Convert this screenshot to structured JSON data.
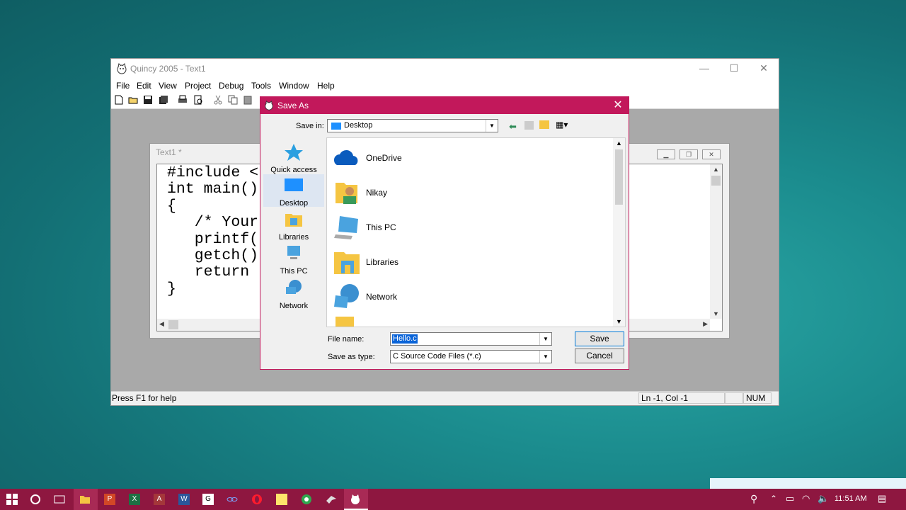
{
  "app": {
    "title": "Quincy 2005 - Text1",
    "menu": [
      "File",
      "Edit",
      "View",
      "Project",
      "Debug",
      "Tools",
      "Window",
      "Help"
    ],
    "status": {
      "help": "Press F1 for help",
      "position": "Ln -1, Col -1",
      "num": "NUM"
    }
  },
  "editor": {
    "window_title": "Text1 *",
    "code_lines": [
      "#include <",
      "int main()",
      "{",
      "   /* Your",
      "   printf(",
      "   getch()",
      "   return",
      "}"
    ]
  },
  "dialog": {
    "title": "Save As",
    "save_in_label": "Save in:",
    "save_in_value": "Desktop",
    "places": [
      "Quick access",
      "Desktop",
      "Libraries",
      "This PC",
      "Network"
    ],
    "files": [
      "OneDrive",
      "Nikay",
      "This PC",
      "Libraries",
      "Network"
    ],
    "file_name_label": "File name:",
    "file_name_value": "Hello.c",
    "save_type_label": "Save as type:",
    "save_type_value": "C Source Code Files (*.c)",
    "save_button": "Save",
    "cancel_button": "Cancel",
    "close_glyph": "✕"
  },
  "taskbar": {
    "time": "11:51 AM",
    "icons": [
      "windows-start-icon",
      "cortana-icon",
      "task-view-icon",
      "file-explorer-icon",
      "powerpoint-icon",
      "excel-icon",
      "access-icon",
      "word-icon",
      "app-g-icon",
      "link-icon",
      "opera-icon",
      "sticky-notes-icon",
      "camtasia-icon",
      "app-bird-icon",
      "quincy-icon"
    ]
  },
  "colors": {
    "dialog_accent": "#c2185b",
    "taskbar": "#8e1740"
  }
}
